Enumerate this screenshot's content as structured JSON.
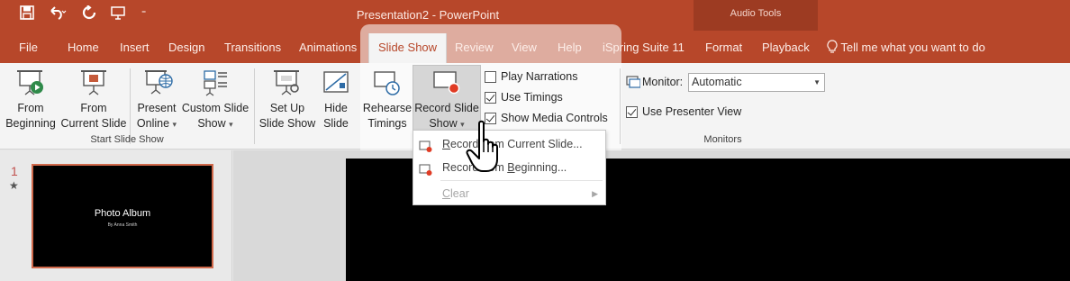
{
  "window": {
    "title": "Presentation2 - PowerPoint",
    "contextual_group": "Audio Tools"
  },
  "qat": {
    "save_icon": "save-icon",
    "undo_icon": "undo-icon",
    "redo_icon": "redo-icon",
    "present_icon": "present-icon",
    "more_icon": "customize-icon"
  },
  "tabs": [
    {
      "label": "File"
    },
    {
      "label": "Home"
    },
    {
      "label": "Insert"
    },
    {
      "label": "Design"
    },
    {
      "label": "Transitions"
    },
    {
      "label": "Animations"
    },
    {
      "label": "Slide Show"
    },
    {
      "label": "Review"
    },
    {
      "label": "View"
    },
    {
      "label": "Help"
    },
    {
      "label": "iSpring Suite 11"
    },
    {
      "label": "Format"
    },
    {
      "label": "Playback"
    }
  ],
  "tell_me": "Tell me what you want to do",
  "ribbon": {
    "from_beginning": {
      "line1": "From",
      "line2": "Beginning"
    },
    "from_current": {
      "line1": "From",
      "line2": "Current Slide"
    },
    "present_online": {
      "line1": "Present",
      "line2": "Online",
      "caret": "▾"
    },
    "custom_show": {
      "line1": "Custom Slide",
      "line2": "Show",
      "caret": "▾"
    },
    "start_group": "Start Slide Show",
    "setup": {
      "line1": "Set Up",
      "line2": "Slide Show"
    },
    "hide": {
      "line1": "Hide",
      "line2": "Slide"
    },
    "rehearse": {
      "line1": "Rehearse",
      "line2": "Timings"
    },
    "record": {
      "line1": "Record Slide",
      "line2": "Show",
      "caret": "▾"
    },
    "play_narrations": {
      "label": "Play Narrations",
      "checked": false
    },
    "use_timings": {
      "label": "Use Timings",
      "checked": true
    },
    "show_media_controls": {
      "label": "Show Media Controls",
      "checked": true
    },
    "monitor_label": "Monitor:",
    "monitor_value": "Automatic",
    "presenter_view": {
      "label": "Use Presenter View",
      "checked": true
    },
    "monitors_group": "Monitors"
  },
  "dropdown": {
    "items": [
      {
        "pre": "",
        "hot": "R",
        "mid": "ecord fr",
        "hot2": "o",
        "post": "m Current Slide..."
      },
      {
        "pre": "",
        "hot": "",
        "mid": "Record from ",
        "hot2": "B",
        "post": "eginning..."
      },
      {
        "pre": "",
        "hot": "C",
        "mid": "",
        "hot2": "",
        "post": "lear"
      }
    ]
  },
  "thumbnail": {
    "number": "1",
    "star": "★",
    "title": "Photo Album",
    "subtitle": "By Anna Smith"
  },
  "colors": {
    "accent": "#b7472a",
    "ribbon_bg": "#f4f4f4",
    "thumb_border": "#d0694b"
  }
}
